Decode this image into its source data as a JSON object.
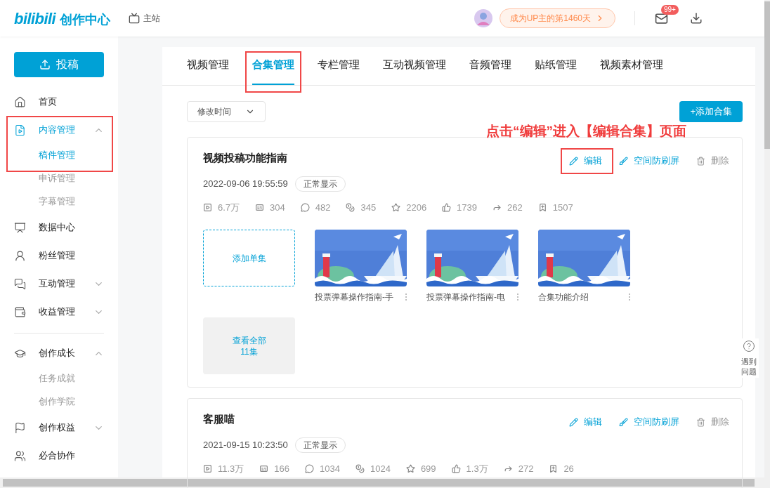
{
  "header": {
    "logo": {
      "brand": "bilibili",
      "suffix": "创作中心"
    },
    "main_site": "主站",
    "milestone": "成为UP主的第1460天",
    "mail_badge": "99+"
  },
  "sidebar": {
    "upload_button": "投稿",
    "sections": [
      [
        {
          "label": "首页",
          "selected": false
        },
        {
          "label": "内容管理",
          "selected": true,
          "expanded": true,
          "highlighted": true,
          "children": [
            {
              "label": "稿件管理",
              "selected": true
            },
            {
              "label": "申诉管理",
              "selected": false
            },
            {
              "label": "字幕管理",
              "selected": false
            }
          ]
        },
        {
          "label": "数据中心",
          "selected": false
        },
        {
          "label": "粉丝管理",
          "selected": false
        },
        {
          "label": "互动管理",
          "selected": false,
          "expanded": false
        },
        {
          "label": "收益管理",
          "selected": false,
          "expanded": false
        }
      ],
      [
        {
          "label": "创作成长",
          "selected": false,
          "expanded": true,
          "children": [
            {
              "label": "任务成就",
              "selected": false
            },
            {
              "label": "创作学院",
              "selected": false
            }
          ]
        },
        {
          "label": "创作权益",
          "selected": false,
          "expanded": false
        },
        {
          "label": "必合协作",
          "selected": false
        }
      ]
    ]
  },
  "tabs": [
    {
      "label": "视频管理",
      "selected": false,
      "highlighted": false
    },
    {
      "label": "合集管理",
      "selected": true,
      "highlighted": true
    },
    {
      "label": "专栏管理",
      "selected": false,
      "highlighted": false
    },
    {
      "label": "互动视频管理",
      "selected": false,
      "highlighted": false
    },
    {
      "label": "音频管理",
      "selected": false,
      "highlighted": false
    },
    {
      "label": "贴纸管理",
      "selected": false,
      "highlighted": false
    },
    {
      "label": "视频素材管理",
      "selected": false,
      "highlighted": false
    }
  ],
  "sort_dropdown": {
    "value": "修改时间"
  },
  "add_button": "+添加合集",
  "annotation": "点击“编辑”进入【编辑合集】页面",
  "collections": [
    {
      "title": "视频投稿功能指南",
      "date": "2022-09-06 19:55:59",
      "status": "正常显示",
      "actions": [
        {
          "kind": "edit",
          "label": "编辑",
          "highlighted": true
        },
        {
          "kind": "antispam",
          "label": "空间防刷屏",
          "highlighted": false
        },
        {
          "kind": "delete",
          "label": "删除",
          "highlighted": false
        }
      ],
      "stats": [
        "6.7万",
        "304",
        "482",
        "345",
        "2206",
        "1739",
        "262",
        "1507"
      ],
      "add_episode": "添加单集",
      "episodes": [
        {
          "title": "投票弹幕操作指南-手",
          "kind": "picture"
        },
        {
          "title": "投票弹幕操作指南-电",
          "kind": "picture"
        },
        {
          "title": "合集功能介绍",
          "kind": "picture"
        }
      ],
      "view_all": {
        "label": "查看全部",
        "count": "11集"
      }
    },
    {
      "title": "客服喵",
      "date": "2021-09-15 10:23:50",
      "status": "正常显示",
      "actions": [
        {
          "kind": "edit",
          "label": "编辑",
          "highlighted": false
        },
        {
          "kind": "antispam",
          "label": "空间防刷屏",
          "highlighted": false
        },
        {
          "kind": "delete",
          "label": "删除",
          "highlighted": false
        }
      ],
      "stats": [
        "11.3万",
        "166",
        "1034",
        "1024",
        "699",
        "1.3万",
        "272",
        "26"
      ]
    }
  ],
  "help": {
    "label": "遇到问题"
  }
}
